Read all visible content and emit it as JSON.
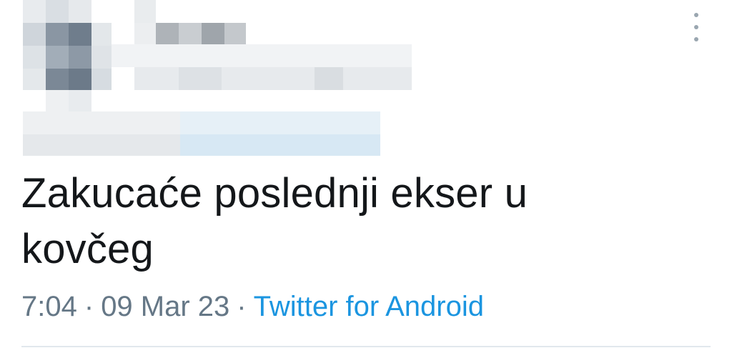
{
  "tweet": {
    "author": {
      "display_name": "",
      "handle": "",
      "redacted": true
    },
    "text": "Zakucaće poslednji ekser u kovčeg",
    "time": "7:04",
    "date": "09 Mar 23",
    "separator": "·",
    "source": "Twitter for Android"
  },
  "icons": {
    "more": "vertical-ellipsis-icon"
  },
  "colors": {
    "text": "#14171a",
    "meta": "#657786",
    "link": "#1b95e0",
    "divider": "#e1e8ed",
    "background": "#ffffff"
  }
}
